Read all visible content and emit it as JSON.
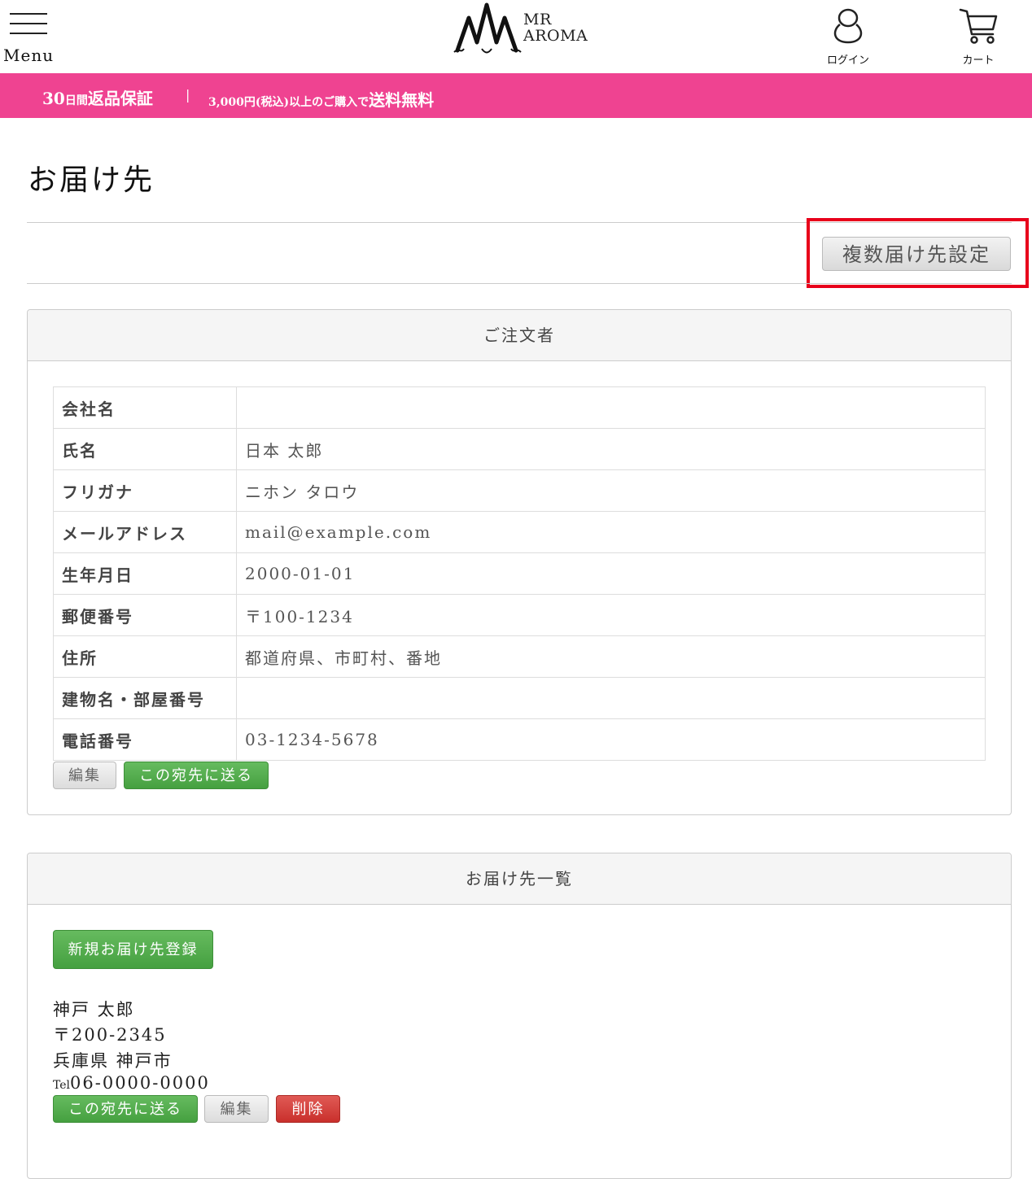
{
  "header": {
    "menu_label": "Menu",
    "logo_line1": "MR",
    "logo_line2": "AROMA",
    "login_label": "ログイン",
    "cart_label": "カート"
  },
  "banner": {
    "days": "30",
    "days_suffix": "日間",
    "guarantee": "返品保証",
    "separator": "|",
    "condition": "3,000円(税込)以上のご購入で",
    "free_shipping": "送料無料",
    "color": "#ef4391"
  },
  "page": {
    "title": "お届け先",
    "multi_button": "複数届け先設定"
  },
  "orderer": {
    "heading": "ご注文者",
    "rows": [
      {
        "label": "会社名",
        "value": ""
      },
      {
        "label": "氏名",
        "value": "日本 太郎"
      },
      {
        "label": "フリガナ",
        "value": "ニホン タロウ"
      },
      {
        "label": "メールアドレス",
        "value": "mail@example.com"
      },
      {
        "label": "生年月日",
        "value": "2000-01-01"
      },
      {
        "label": "郵便番号",
        "value": "〒100-1234"
      },
      {
        "label": "住所",
        "value": "都道府県、市町村、番地"
      },
      {
        "label": "建物名・部屋番号",
        "value": ""
      },
      {
        "label": "電話番号",
        "value": "03-1234-5678"
      }
    ],
    "edit_button": "編集",
    "send_button": "この宛先に送る"
  },
  "destinations": {
    "heading": "お届け先一覧",
    "new_button": "新規お届け先登録",
    "entry": {
      "name": "神戸 太郎",
      "postal": "〒200-2345",
      "address": "兵庫県 神戸市",
      "tel_prefix": "Tel",
      "tel": "06-0000-0000",
      "send_button": "この宛先に送る",
      "edit_button": "編集",
      "delete_button": "削除"
    }
  }
}
